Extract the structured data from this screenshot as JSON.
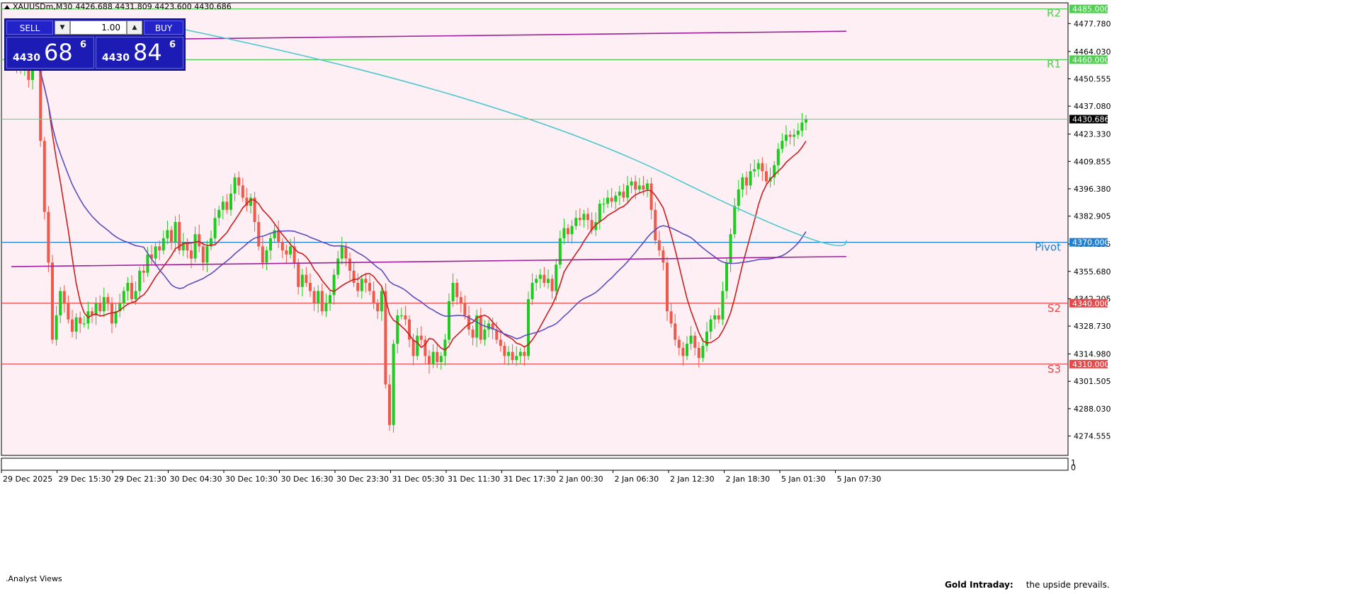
{
  "header": {
    "symbol": "XAUUSDm,M30",
    "ohlc": "4426.688 4431.809 4423.600 4430.686"
  },
  "trade_panel": {
    "sell_label": "SELL",
    "buy_label": "BUY",
    "lot": "1.00",
    "bid_small": "4430",
    "bid_big": "68",
    "bid_sup": "6",
    "ask_small": "4430",
    "ask_big": "84",
    "ask_sup": "6"
  },
  "subwindow": {
    "indicator_label": ".Analyst Views",
    "note_title": "Gold Intraday:",
    "note_text": "the upside prevails.",
    "scale_top": "1",
    "scale_bottom": "0"
  },
  "colors": {
    "plot_bg": "#fdeff3",
    "bull": "#1ecb1e",
    "bear": "#f0584a",
    "pivot": "#1f7fd1",
    "support": "#e8474a",
    "resistance": "#4fcf4f",
    "ma_fast": "#cc1e1e",
    "ma_mid": "#5b4fbf",
    "ma_slow": "#4fc8cf",
    "ma_long": "#a01f9a",
    "current_price_bg": "#000000"
  },
  "chart_data": {
    "type": "candlestick",
    "symbol": "XAUUSDm",
    "timeframe": "M30",
    "ylim": [
      4265.0,
      4488.0
    ],
    "y_ticks": [
      "4477.780",
      "4464.030",
      "4450.555",
      "4437.080",
      "4423.330",
      "4409.855",
      "4396.380",
      "4382.905",
      "4369.155",
      "4355.680",
      "4342.205",
      "4328.730",
      "4314.980",
      "4301.505",
      "4288.030",
      "4274.555"
    ],
    "x_ticks": [
      "29 Dec 2025",
      "29 Dec 15:30",
      "29 Dec 21:30",
      "30 Dec 04:30",
      "30 Dec 10:30",
      "30 Dec 16:30",
      "30 Dec 23:30",
      "31 Dec 05:30",
      "31 Dec 11:30",
      "31 Dec 17:30",
      "2 Jan 00:30",
      "2 Jan 06:30",
      "2 Jan 12:30",
      "2 Jan 18:30",
      "5 Jan 01:30",
      "5 Jan 07:30"
    ],
    "current_price": "4430.686",
    "levels": [
      {
        "name": "R2",
        "value": 4485.0,
        "label": "4485.000",
        "kind": "resistance"
      },
      {
        "name": "R1",
        "value": 4460.0,
        "label": "4460.000",
        "kind": "resistance"
      },
      {
        "name": "Pivot",
        "value": 4370.0,
        "label": "4370.000",
        "kind": "pivot"
      },
      {
        "name": "S2",
        "value": 4340.0,
        "label": "4340.000",
        "kind": "support"
      },
      {
        "name": "S3",
        "value": 4310.0,
        "label": "4310.000",
        "kind": "support"
      }
    ],
    "close": [
      4466,
      4458,
      4455,
      4462,
      4450,
      4462,
      4458,
      4420,
      4385,
      4360,
      4322,
      4334,
      4346,
      4340,
      4332,
      4326,
      4333,
      4330,
      4330,
      4336,
      4334,
      4340,
      4336,
      4343,
      4340,
      4330,
      4336,
      4340,
      4346,
      4350,
      4342,
      4346,
      4356,
      4355,
      4364,
      4362,
      4368,
      4366,
      4372,
      4376,
      4370,
      4380,
      4366,
      4370,
      4366,
      4362,
      4374,
      4368,
      4360,
      4368,
      4372,
      4382,
      4386,
      4390,
      4386,
      4394,
      4402,
      4398,
      4392,
      4388,
      4392,
      4380,
      4368,
      4360,
      4366,
      4372,
      4376,
      4370,
      4366,
      4364,
      4368,
      4360,
      4348,
      4354,
      4350,
      4346,
      4340,
      4346,
      4336,
      4340,
      4344,
      4354,
      4362,
      4368,
      4362,
      4356,
      4350,
      4346,
      4352,
      4350,
      4346,
      4340,
      4336,
      4346,
      4300,
      4280,
      4320,
      4334,
      4334,
      4332,
      4322,
      4314,
      4324,
      4322,
      4314,
      4310,
      4316,
      4311,
      4314,
      4322,
      4341,
      4350,
      4343,
      4340,
      4334,
      4327,
      4323,
      4334,
      4322,
      4327,
      4330,
      4327,
      4322,
      4319,
      4314,
      4316,
      4312,
      4314,
      4316,
      4314,
      4342,
      4350,
      4352,
      4354,
      4350,
      4352,
      4346,
      4359,
      4372,
      4377,
      4374,
      4378,
      4382,
      4381,
      4384,
      4381,
      4376,
      4380,
      4389,
      4389,
      4392,
      4390,
      4393,
      4395,
      4392,
      4398,
      4400,
      4396,
      4398,
      4396,
      4399,
      4386,
      4371,
      4366,
      4360,
      4336,
      4330,
      4322,
      4318,
      4314,
      4320,
      4324,
      4318,
      4313,
      4319,
      4326,
      4332,
      4334,
      4332,
      4346,
      4360,
      4374,
      4388,
      4396,
      4402,
      4398,
      4405,
      4406,
      4409,
      4405,
      4400,
      4402,
      4408,
      4416,
      4420,
      4423,
      4422,
      4423,
      4425,
      4429,
      4430.686
    ]
  }
}
